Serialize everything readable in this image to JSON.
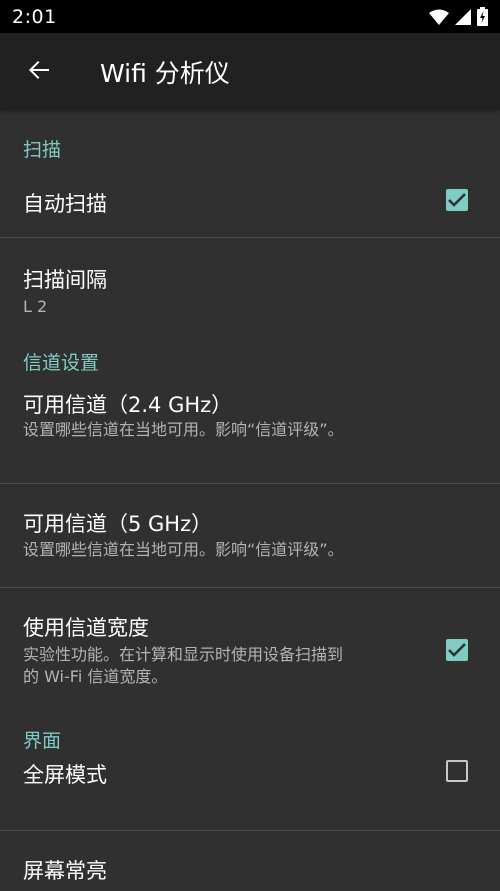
{
  "status_bar": {
    "time": "2:01",
    "icons": [
      "wifi-icon",
      "signal-icon",
      "battery-charging-icon"
    ]
  },
  "app_bar": {
    "title": "Wifi 分析仪",
    "back_icon": "arrow-back-icon"
  },
  "colors": {
    "accent": "#80cbc4",
    "background": "#303030",
    "toolbar": "#212121",
    "divider": "#4a4a4a"
  },
  "sections": {
    "scan": {
      "header": "扫描",
      "auto_scan": {
        "title": "自动扫描",
        "checked": true
      },
      "scan_interval": {
        "title": "扫描间隔",
        "summary": "L 2"
      }
    },
    "channel": {
      "header": "信道设置",
      "channels_24": {
        "title": "可用信道（2.4 GHz）",
        "summary": "设置哪些信道在当地可用。影响“信道评级”。"
      },
      "channels_5": {
        "title": "可用信道（5 GHz）",
        "summary": "设置哪些信道在当地可用。影响“信道评级”。"
      },
      "channel_width": {
        "title": "使用信道宽度",
        "summary_line1": "实验性功能。在计算和显示时使用设备扫描到",
        "summary_line2": "的 Wi-Fi 信道宽度。",
        "checked": true
      }
    },
    "ui": {
      "header": "界面",
      "fullscreen": {
        "title": "全屏模式",
        "checked": false
      },
      "screen_on": {
        "title": "屏幕常亮"
      }
    }
  }
}
